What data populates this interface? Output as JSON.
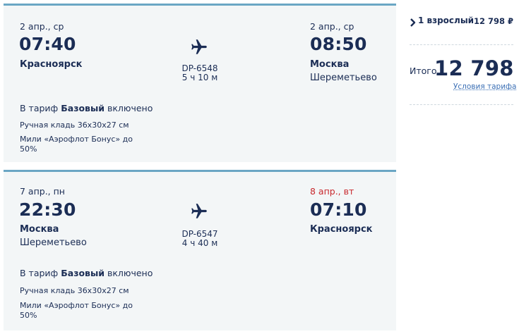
{
  "outbound": {
    "dep_date": "2 апр., ср",
    "dep_time": "07:40",
    "dep_city": "Красноярск",
    "dep_airport": "",
    "flight_no": "DP-6548",
    "duration": "5 ч 10 м",
    "arr_date": "2 апр., ср",
    "arr_time": "08:50",
    "arr_city": "Москва",
    "arr_airport": "Шереметьево",
    "tariff_prefix": "В тариф",
    "tariff_name": "Базовый",
    "tariff_suffix": "включено",
    "baggage": "Ручная кладь 36х30х27 см",
    "miles_line1": "Мили «Аэрофлот Бонус» до",
    "miles_line2": "50%"
  },
  "return": {
    "dep_date": "7 апр., пн",
    "dep_time": "22:30",
    "dep_city": "Москва",
    "dep_airport": "Шереметьево",
    "flight_no": "DP-6547",
    "duration": "4 ч 40 м",
    "arr_date": "8 апр., вт",
    "arr_time": "07:10",
    "arr_city": "Красноярск",
    "arr_airport": "",
    "tariff_prefix": "В тариф",
    "tariff_name": "Базовый",
    "tariff_suffix": "включено",
    "baggage": "Ручная кладь 36х30х27 см",
    "miles_line1": "Мили «Аэрофлот Бонус» до",
    "miles_line2": "50%"
  },
  "summary": {
    "chevron_icon": "chevron-right-icon",
    "passengers": "1 взрослый",
    "passengers_price": "12 798 ₽",
    "total_label": "Итого",
    "total_price": "12 798 ₽",
    "terms_link": "Условия тарифа"
  },
  "colors": {
    "text": "#1b2d55",
    "card_bg": "#f3f6f7",
    "card_border": "#6aa6c4",
    "next_day_date": "#c8282d",
    "link": "#3b6fb5"
  }
}
